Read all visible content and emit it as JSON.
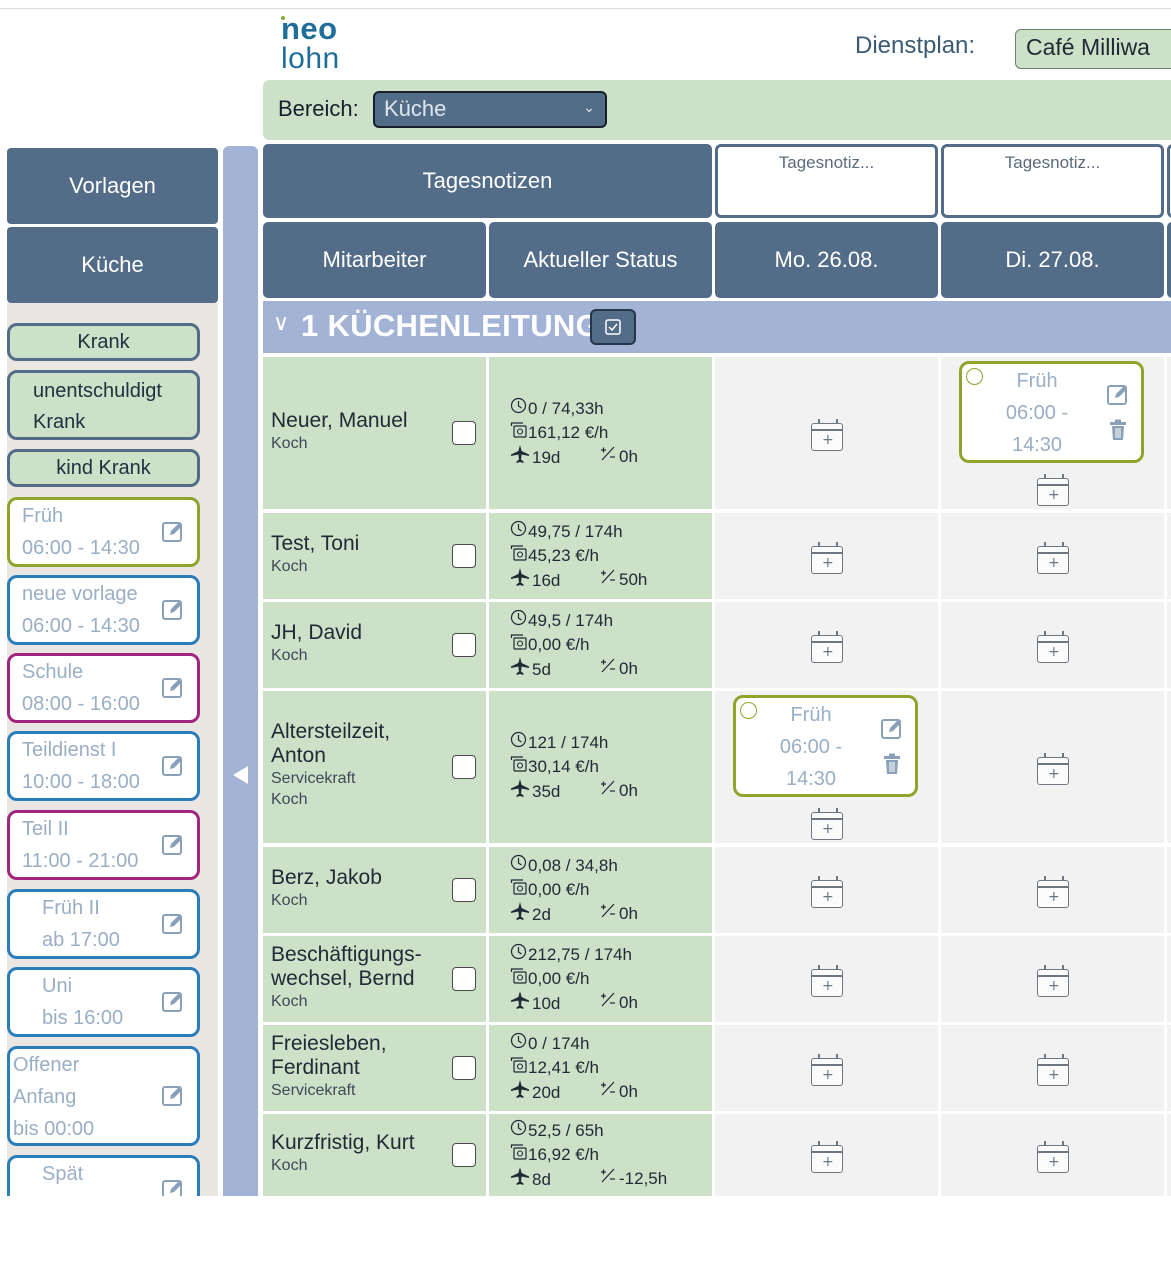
{
  "header": {
    "logo_line1": "neo",
    "logo_line2": "lohn",
    "plan_label": "Dienstplan:",
    "plan_value": "Café Milliwa"
  },
  "filter": {
    "label": "Bereich:",
    "value": "Küche"
  },
  "sidebar": {
    "templates_button": "Vorlagen",
    "area_button": "Küche",
    "absences": [
      "Krank",
      "unentschuldigt Krank",
      "kind Krank"
    ],
    "templates": [
      {
        "name": "Früh",
        "time": "06:00 - 14:30",
        "color": "#8ea52c"
      },
      {
        "name": "neue vorlage",
        "time": "06:00 - 14:30",
        "color": "#2a7dbb"
      },
      {
        "name": "Schule",
        "time": "08:00 - 16:00",
        "color": "#a0257f"
      },
      {
        "name": "Teildienst I",
        "time": "10:00 - 18:00",
        "color": "#2a7dbb"
      },
      {
        "name": "Teil II",
        "time": "11:00 - 21:00",
        "color": "#a0257f"
      },
      {
        "name": "Früh II",
        "time": "ab 17:00",
        "color": "#2a7dbb"
      },
      {
        "name": "Uni",
        "time": "bis 16:00",
        "color": "#2a7dbb"
      },
      {
        "name": "Offener Anfang",
        "time": "bis 00:00",
        "color": "#2a7dbb"
      },
      {
        "name": "Spät",
        "time": "",
        "color": "#2a7dbb"
      }
    ]
  },
  "grid": {
    "notes_header": "Tagesnotizen",
    "note_placeholder": "Tagesnotiz...",
    "col_employee": "Mitarbeiter",
    "col_status": "Aktueller Status",
    "days": [
      "Mo. 26.08.",
      "Di. 27.08."
    ],
    "group_title": "1 KÜCHENLEITUNG",
    "shift": {
      "name": "Früh",
      "time_start": "06:00 -",
      "time_end": "14:30"
    }
  },
  "employees": [
    {
      "name": [
        "Neuer, Manuel"
      ],
      "roles": [
        "Koch"
      ],
      "hours": "0 / 74,33h",
      "wage": "161,12 €/h",
      "vacation": "19d",
      "overtime": "0h"
    },
    {
      "name": [
        "Test, Toni"
      ],
      "roles": [
        "Koch"
      ],
      "hours": "49,75 / 174h",
      "wage": "45,23 €/h",
      "vacation": "16d",
      "overtime": "50h"
    },
    {
      "name": [
        "JH, David"
      ],
      "roles": [
        "Koch"
      ],
      "hours": "49,5 / 174h",
      "wage": "0,00 €/h",
      "vacation": "5d",
      "overtime": "0h"
    },
    {
      "name": [
        "Altersteilzeit,",
        "Anton"
      ],
      "roles": [
        "Servicekraft",
        "Koch"
      ],
      "hours": "121 / 174h",
      "wage": "30,14 €/h",
      "vacation": "35d",
      "overtime": "0h"
    },
    {
      "name": [
        "Berz, Jakob"
      ],
      "roles": [
        "Koch"
      ],
      "hours": "0,08 / 34,8h",
      "wage": "0,00 €/h",
      "vacation": "2d",
      "overtime": "0h"
    },
    {
      "name": [
        "Beschäftigungs-",
        "wechsel, Bernd"
      ],
      "roles": [
        "Koch"
      ],
      "hours": "212,75 / 174h",
      "wage": "0,00 €/h",
      "vacation": "10d",
      "overtime": "0h"
    },
    {
      "name": [
        "Freiesleben,",
        "Ferdinant"
      ],
      "roles": [
        "Servicekraft"
      ],
      "hours": "0 / 174h",
      "wage": "12,41 €/h",
      "vacation": "20d",
      "overtime": "0h"
    },
    {
      "name": [
        "Kurzfristig, Kurt"
      ],
      "roles": [
        "Koch"
      ],
      "hours": "52,5 / 65h",
      "wage": "16,92 €/h",
      "vacation": "8d",
      "overtime": "-12,5h"
    }
  ]
}
